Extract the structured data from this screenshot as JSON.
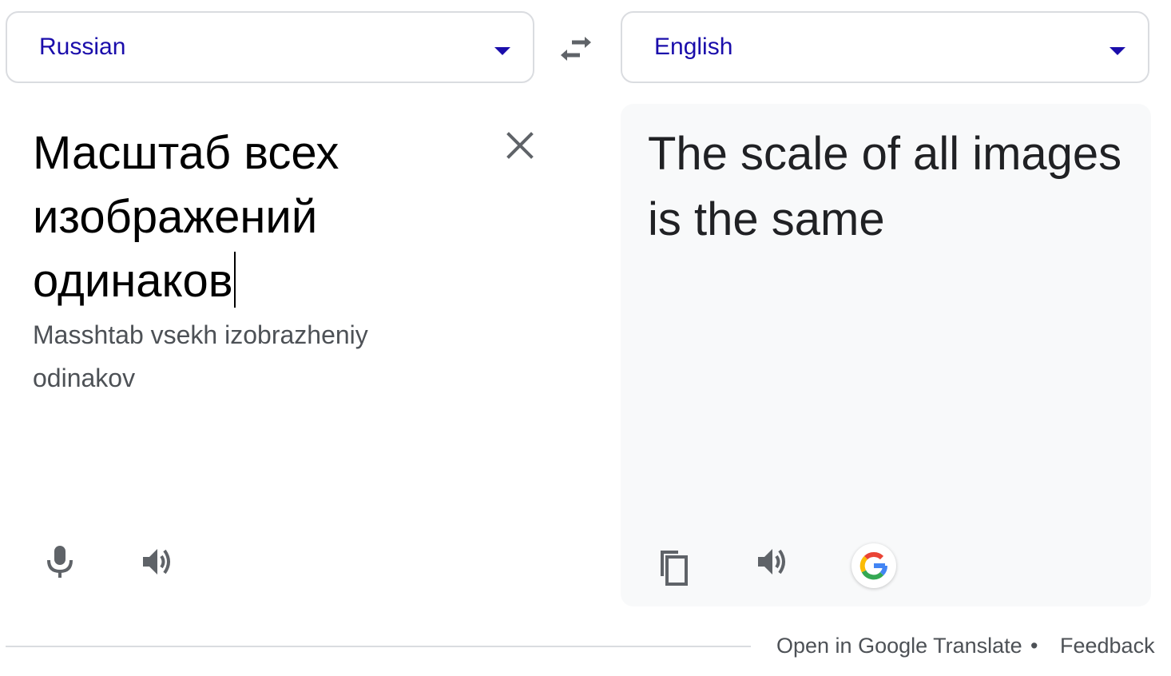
{
  "source_language": {
    "label": "Russian",
    "icon": "chevron-down-icon"
  },
  "target_language": {
    "label": "English",
    "icon": "chevron-down-icon"
  },
  "swap": {
    "icon": "swap-arrows-icon"
  },
  "source": {
    "text": "Масштаб всех изображений одинаков",
    "transliteration": "Masshtab vsekh izobrazheniy odinakov",
    "clear_icon": "close-icon",
    "microphone_icon": "microphone-icon",
    "listen_icon": "speaker-icon"
  },
  "target": {
    "text": "The scale of all images is the same",
    "copy_icon": "copy-icon",
    "listen_icon": "speaker-icon",
    "google_icon": "google-g-icon"
  },
  "footer": {
    "open_link": "Open in Google Translate",
    "separator": "•",
    "feedback_link": "Feedback"
  },
  "colors": {
    "accent_link": "#1a0dab",
    "icon_gray": "#5f6368",
    "border": "#dadce0",
    "target_bg": "#f8f9fa"
  }
}
